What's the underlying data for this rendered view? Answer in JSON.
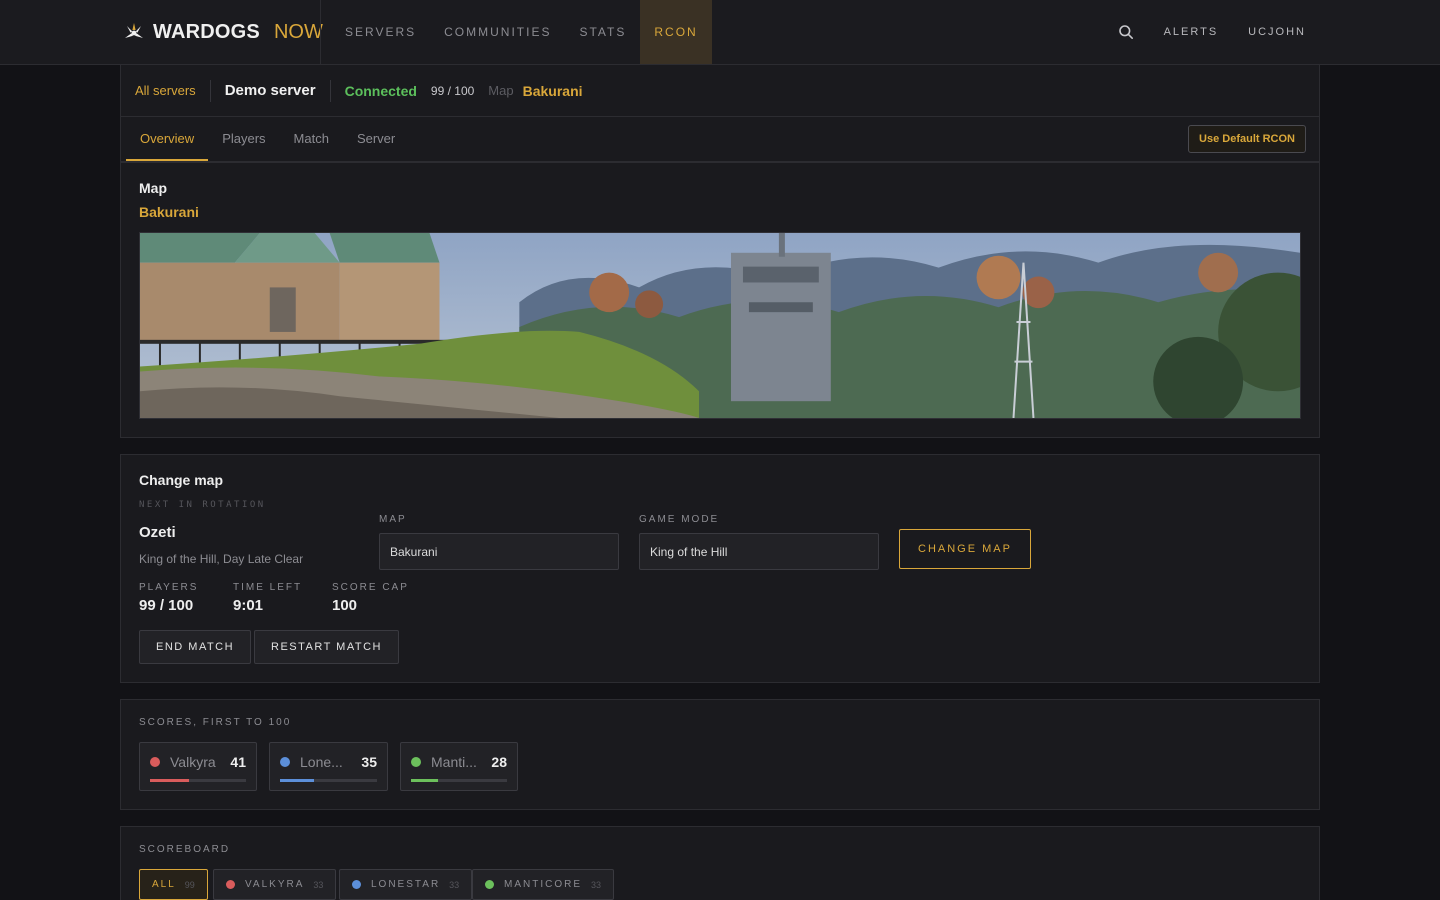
{
  "brand": {
    "name": "WARDOGS",
    "accent": "NOW"
  },
  "nav": {
    "items": [
      {
        "label": "SERVERS"
      },
      {
        "label": "COMMUNITIES"
      },
      {
        "label": "STATS"
      },
      {
        "label": "RCON"
      }
    ]
  },
  "top_right": {
    "alerts": "ALERTS",
    "user": "UCJOHN"
  },
  "server_bar": {
    "all_servers": "All servers",
    "server_name": "Demo server",
    "status": "Connected",
    "players": "99 / 100",
    "map_key": "Map",
    "map_value": "Bakurani"
  },
  "tabs": [
    {
      "label": "Overview"
    },
    {
      "label": "Players"
    },
    {
      "label": "Match"
    },
    {
      "label": "Server"
    }
  ],
  "rcon_button": "Use Default RCON",
  "map_card": {
    "title": "Map",
    "map_name": "Bakurani"
  },
  "change_map": {
    "title": "Change map",
    "rotation_label": "NEXT IN ROTATION",
    "next_map": "Ozeti",
    "next_mode": "King of the Hill, Day Late Clear",
    "stats": [
      {
        "label": "PLAYERS",
        "value": "99 / 100"
      },
      {
        "label": "TIME LEFT",
        "value": "9:01"
      },
      {
        "label": "SCORE CAP",
        "value": "100"
      }
    ],
    "map_field_label": "MAP",
    "map_field_value": "Bakurani",
    "mode_field_label": "GAME MODE",
    "mode_field_value": "King of the Hill",
    "change_button": "CHANGE MAP",
    "end_button": "END MATCH",
    "restart_button": "RESTART MATCH"
  },
  "scores": {
    "title": "SCORES, FIRST TO 100",
    "teams": [
      {
        "name": "Valkyra",
        "score": "41",
        "progress": 0.41,
        "color": "#d95c5c"
      },
      {
        "name": "Lone...",
        "score": "35",
        "progress": 0.35,
        "color": "#5c8fd9"
      },
      {
        "name": "Manti...",
        "score": "28",
        "progress": 0.28,
        "color": "#6cc05c"
      }
    ]
  },
  "scoreboard": {
    "title": "SCOREBOARD",
    "filters": [
      {
        "label": "ALL",
        "count": "99"
      },
      {
        "label": "VALKYRA",
        "count": "33",
        "color": "#d95c5c"
      },
      {
        "label": "LONESTAR",
        "count": "33",
        "color": "#5c8fd9"
      },
      {
        "label": "MANTICORE",
        "count": "33",
        "color": "#6cc05c"
      }
    ]
  },
  "colors": {
    "accent": "#d9a73a",
    "connected": "#5cbf5c",
    "background": "#121216",
    "panel": "#1a1a1e"
  }
}
